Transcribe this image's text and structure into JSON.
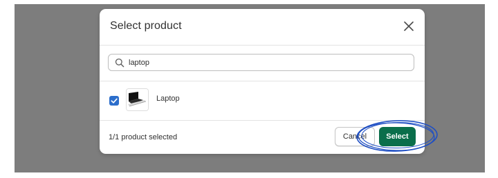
{
  "modal": {
    "title": "Select product",
    "close_icon": "close-icon"
  },
  "search": {
    "value": "laptop",
    "icon": "search-icon"
  },
  "results": [
    {
      "label": "Laptop",
      "checked": true,
      "thumbnail_icon": "laptop-thumbnail"
    }
  ],
  "footer": {
    "selected_count": "1/1 product selected",
    "cancel_label": "Cancel",
    "select_label": "Select"
  },
  "colors": {
    "primary": "#0a6e4b",
    "checkbox": "#2c6ecb",
    "annotation": "#1f4fc4",
    "overlay": "#7d7d7d"
  }
}
